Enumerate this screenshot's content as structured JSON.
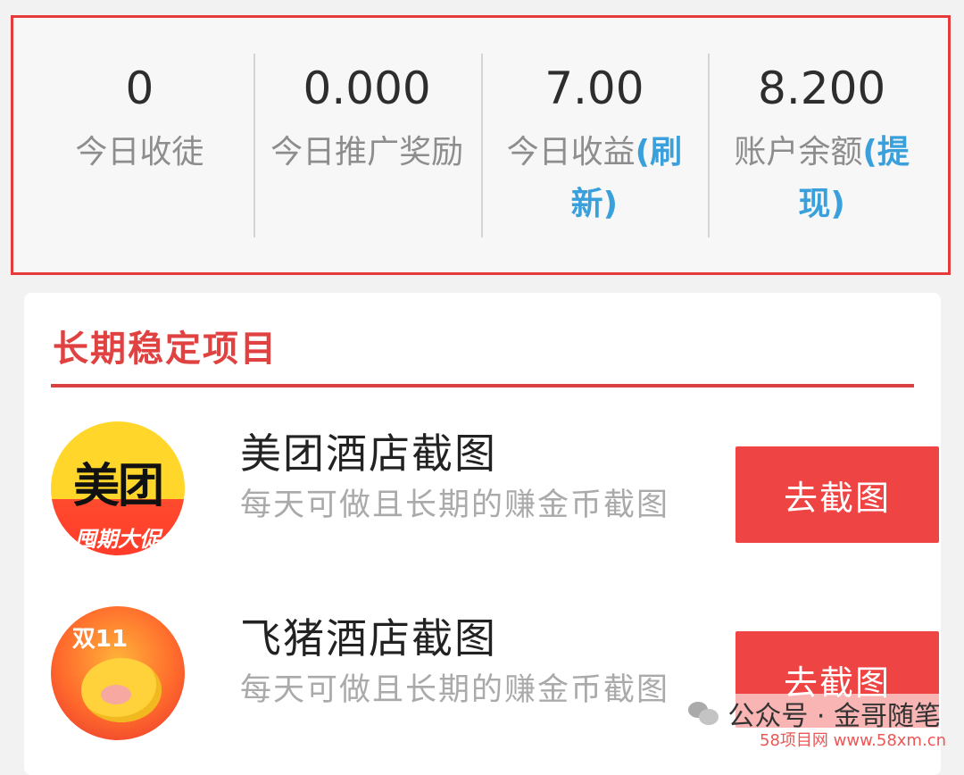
{
  "stats": [
    {
      "value": "0",
      "label": "今日收徒",
      "link": ""
    },
    {
      "value": "0.000",
      "label": "今日推广奖励",
      "link": ""
    },
    {
      "value": "7.00",
      "label": "今日收益",
      "link": "(刷新)"
    },
    {
      "value": "8.200",
      "label": "账户余额",
      "link": "(提现)"
    }
  ],
  "section": {
    "title": "长期稳定项目"
  },
  "projects": [
    {
      "icon_name": "meituan-logo-icon",
      "icon_brand": "美团",
      "icon_tag": "囤期大促",
      "title": "美团酒店截图",
      "desc": "每天可做且长期的赚金币截图",
      "button": "去截图"
    },
    {
      "icon_name": "feizhu-logo-icon",
      "icon_tag": "双11",
      "title": "飞猪酒店截图",
      "desc": "每天可做且长期的赚金币截图",
      "button": "去截图"
    }
  ],
  "watermark": {
    "text": "公众号 · 金哥随笔",
    "sub": "58项目网 www.58xm.cn"
  },
  "colors": {
    "accent_red": "#e53b3b",
    "link_blue": "#3aa0db",
    "button_red": "#ef4444"
  }
}
